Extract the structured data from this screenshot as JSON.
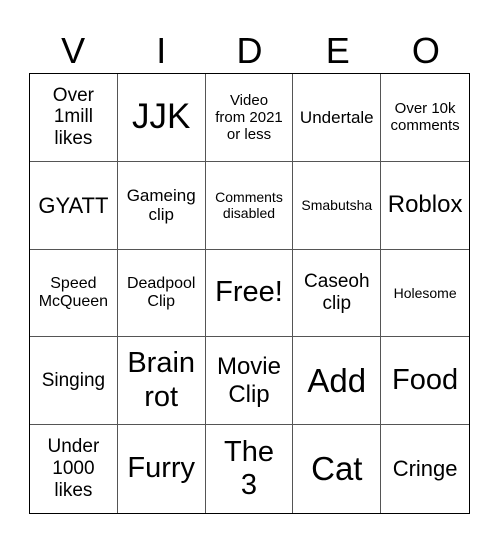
{
  "header": {
    "letters": [
      "V",
      "I",
      "D",
      "E",
      "O"
    ]
  },
  "cells": [
    "Over\n1mill\nlikes",
    "JJK",
    "Video\nfrom 2021\nor less",
    "Undertale",
    "Over 10k\ncomments",
    "GYATT",
    "Gameing\nclip",
    "Comments\ndisabled",
    "Smabutsha",
    "Roblox",
    "Speed\nMcQueen",
    "Deadpool\nClip",
    "Free!",
    "Caseoh\nclip",
    "Holesome",
    "Singing",
    "Brain\nrot",
    "Movie\nClip",
    "Add",
    "Food",
    "Under\n1000\nlikes",
    "Furry",
    "The\n3",
    "Cat",
    "Cringe"
  ]
}
